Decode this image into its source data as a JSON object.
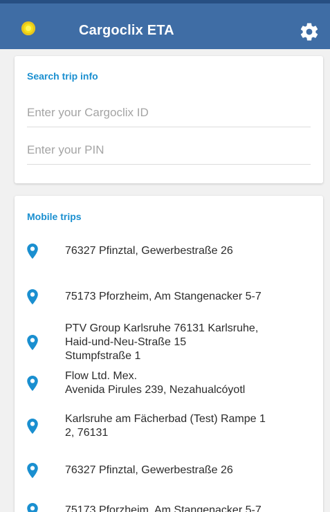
{
  "header": {
    "title": "Cargoclix ETA",
    "status_icon": "status-indicator-icon",
    "settings_icon": "gear-icon"
  },
  "search": {
    "title": "Search trip info",
    "id_placeholder": "Enter your Cargoclix ID",
    "pin_placeholder": "Enter your PIN"
  },
  "trips": {
    "title": "Mobile trips",
    "items": [
      {
        "text": "76327 Pfinztal, Gewerbestraße 26"
      },
      {
        "text": "75173 Pforzheim, Am Stangenacker 5-7"
      },
      {
        "text": "PTV Group Karlsruhe 76131 Karlsruhe,\nHaid-und-Neu-Straße 15\nStumpfstraße 1"
      },
      {
        "text": "Flow Ltd. Mex.\nAvenida Pirules 239, Nezahualcóyotl"
      },
      {
        "text": "Karlsruhe am Fächerbad (Test) Rampe 1\n2, 76131"
      },
      {
        "text": "76327 Pfinztal, Gewerbestraße 26"
      },
      {
        "text": "75173 Pforzheim, Am Stangenacker 5-7"
      }
    ]
  },
  "colors": {
    "appbar": "#3f6da5",
    "accent": "#1a8fd0",
    "status": "#f5e11a"
  }
}
